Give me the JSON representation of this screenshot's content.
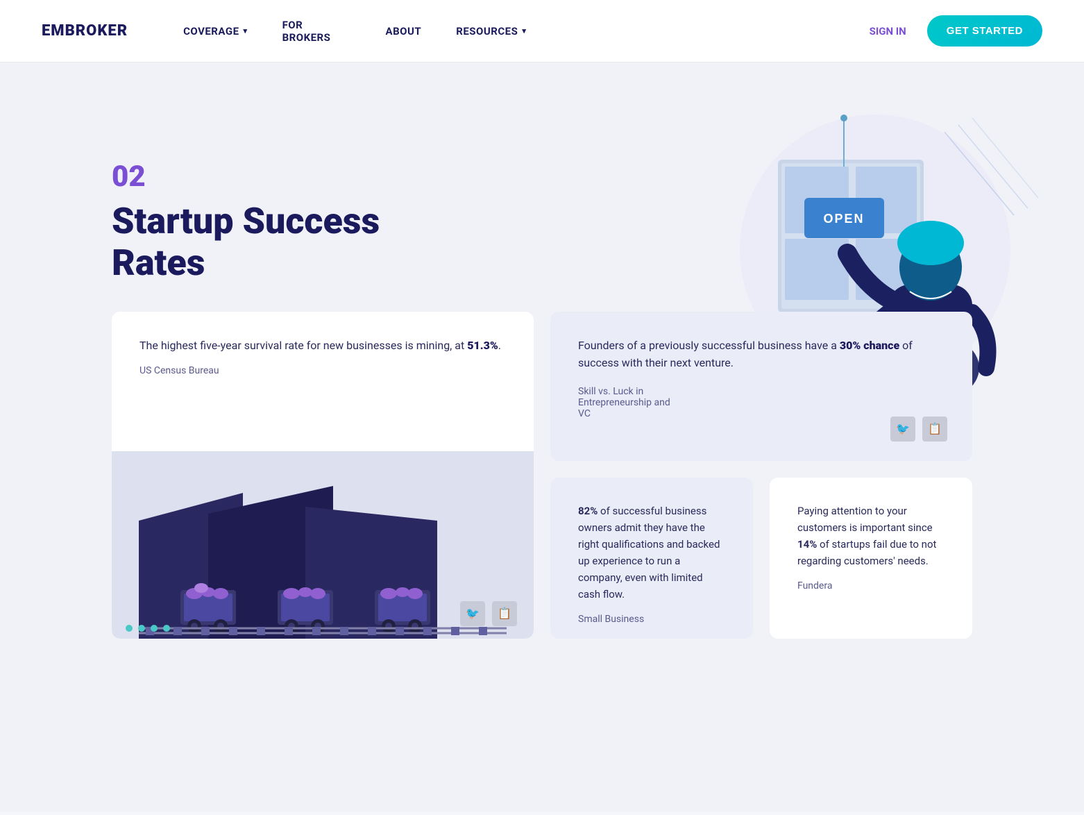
{
  "nav": {
    "logo": "EMBROKER",
    "links": [
      {
        "label": "COVERAGE",
        "hasDropdown": true
      },
      {
        "label": "FOR BROKERS",
        "hasDropdown": false
      },
      {
        "label": "ABOUT",
        "hasDropdown": false
      },
      {
        "label": "RESOURCES",
        "hasDropdown": true
      }
    ],
    "signIn": "SIGN IN",
    "getStarted": "GET STARTED"
  },
  "hero": {
    "sectionNumber": "02",
    "title": "Startup Success Rates",
    "openSign": "OPEN"
  },
  "cards": {
    "card1": {
      "text_before": "The highest five-year survival rate for new businesses is mining, at ",
      "highlight": "51.3%",
      "text_after": ".",
      "source": "US Census Bureau"
    },
    "card2": {
      "text_before": "Founders of a previously successful business have a ",
      "highlight": "30% chance",
      "text_after": " of success with their next venture.",
      "source": "Skill vs. Luck in\nEntrepreneurship and\nVC"
    },
    "card3": {
      "text_before": "",
      "highlight": "82%",
      "text_after": " of successful business owners admit they have the right qualifications and backed up experience to run a company, even with limited cash flow.",
      "source": "Small Business"
    },
    "card4": {
      "text_before": "Paying attention to your customers is important since ",
      "highlight": "14%",
      "text_after": " of startups fail due to not regarding customers' needs.",
      "source": "Fundera"
    }
  },
  "icons": {
    "twitter": "🐦",
    "copy": "📋",
    "caret": "▾"
  }
}
